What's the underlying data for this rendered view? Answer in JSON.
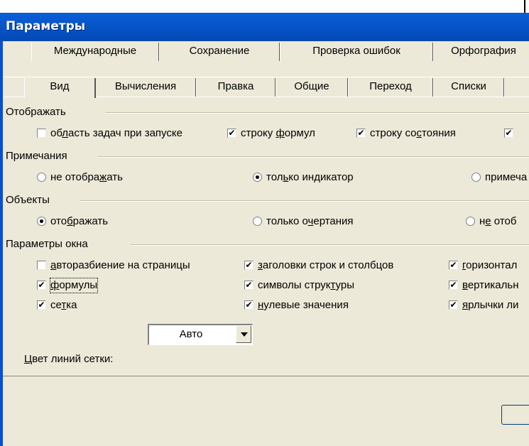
{
  "window": {
    "title": "Параметры"
  },
  "tabs_row1": [
    "Международные",
    "Сохранение",
    "Проверка ошибок",
    "Орфография"
  ],
  "tabs_row2": [
    "Вид",
    "Вычисления",
    "Правка",
    "Общие",
    "Переход",
    "Списки"
  ],
  "display": {
    "group_label": "Отображать",
    "task_pane": {
      "pre": "об",
      "key": "л",
      "post": "асть задач при запуске",
      "checked": false
    },
    "formula_bar": {
      "pre": "строку ",
      "key": "ф",
      "post": "ормул",
      "checked": true
    },
    "status_bar": {
      "pre": "строку со",
      "key": "с",
      "post": "тояния",
      "checked": true
    }
  },
  "comments": {
    "group_label": "Примечания",
    "none": {
      "pre": "не отобра",
      "key": "ж",
      "post": "ать",
      "checked": false
    },
    "indicator": {
      "pre": "тол",
      "key": "ь",
      "post": "ко индикатор",
      "checked": true
    },
    "comment_truncated": {
      "text": "примеча",
      "checked": false
    }
  },
  "objects": {
    "group_label": "Объекты",
    "show": {
      "pre": "ото",
      "key": "б",
      "post": "ражать",
      "checked": true
    },
    "outlines": {
      "pre": "только о",
      "key": "ч",
      "post": "ертания",
      "checked": false
    },
    "hide_truncated": {
      "pre": "н",
      "key": "е",
      "post": " отоб",
      "checked": false
    }
  },
  "window_options": {
    "group_label": "Параметры окна",
    "page_breaks": {
      "pre": "",
      "key": "а",
      "post": "вторазбиение на страницы",
      "checked": false
    },
    "formulas": {
      "pre": "",
      "key": "ф",
      "post": "ормулы",
      "checked": true
    },
    "gridlines": {
      "pre": "се",
      "key": "т",
      "post": "ка",
      "checked": true
    },
    "row_col_headers": {
      "pre": "",
      "key": "з",
      "post": "аголовки строк и столбцов",
      "checked": true
    },
    "outline_symbols": {
      "pre": "символы струк",
      "key": "т",
      "post": "уры",
      "checked": true
    },
    "zero_values": {
      "pre": "",
      "key": "н",
      "post": "улевые значения",
      "checked": true
    },
    "horizontal_truncated": {
      "pre": "",
      "key": "г",
      "post": "оризонтал",
      "checked": true
    },
    "vertical_truncated": {
      "pre": "",
      "key": "в",
      "post": "ертикальн",
      "checked": true
    },
    "sheet_tabs_truncated": {
      "pre": "",
      "key": "я",
      "post": "рлычки ли",
      "checked": true
    },
    "gridline_color_label": {
      "pre": "",
      "key": "Ц",
      "post": "вет линий сетки:"
    },
    "gridline_color_value": "Авто"
  },
  "check_mark": "✔"
}
